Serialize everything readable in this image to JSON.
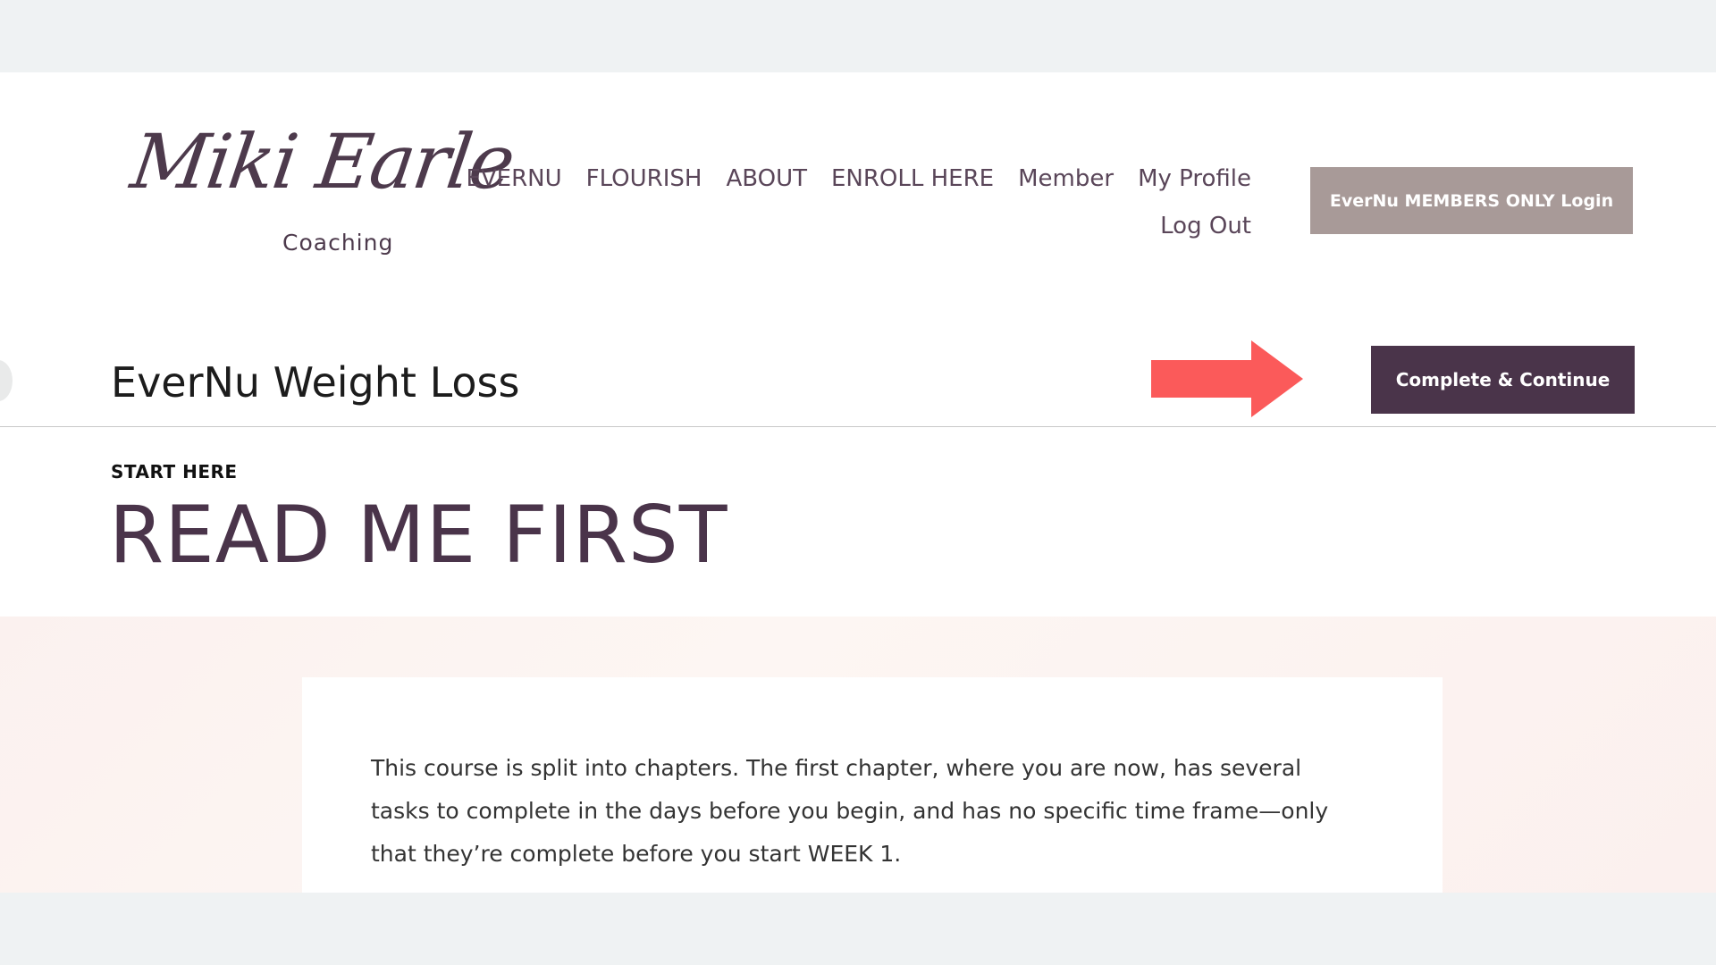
{
  "header": {
    "logo_script": "Miki Earle",
    "logo_sub": "Coaching",
    "nav_row1": [
      "EVERNU",
      "FLOURISH",
      "ABOUT",
      "ENROLL HERE",
      "Member",
      "My Profile"
    ],
    "nav_row2": [
      "Log Out"
    ],
    "members_button": "EverNu MEMBERS ONLY Login"
  },
  "course": {
    "title": "EverNu Weight Loss",
    "complete_button": "Complete & Continue"
  },
  "lesson": {
    "section": "START HERE",
    "title": "READ ME FIRST",
    "body": "This course is split into chapters. The first chapter, where you are now, has several tasks to complete in the days before you begin, and has no specific time frame—only that they’re complete before you start WEEK 1."
  },
  "colors": {
    "brand_plum": "#4a344a",
    "members_button_bg": "#a89a98",
    "arrow": "#fb5a5a",
    "content_bg": "#fbf1ef"
  },
  "icons": {
    "annotation_arrow": "arrow-right-icon"
  }
}
